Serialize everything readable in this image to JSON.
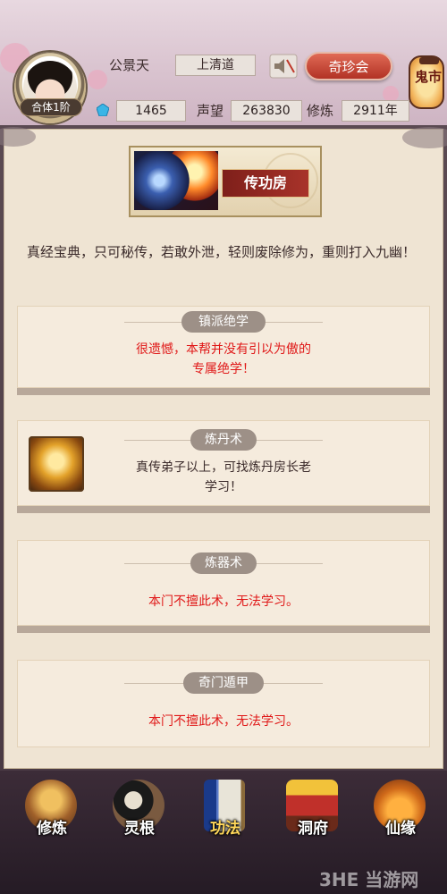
{
  "player": {
    "name": "公景天",
    "sect": "上清道",
    "rank": "合体1阶",
    "spirit_stones": "1465",
    "reputation_label": "声望",
    "reputation": "263830",
    "cultivation_label": "修炼",
    "cultivation": "2911年"
  },
  "header": {
    "treasure_button": "奇珍会",
    "ghost_market": "鬼市",
    "sound_icon": "speaker-muted-icon"
  },
  "banner": {
    "title": "传功房"
  },
  "intro_text": "真经宝典，只可秘传，若敢外泄，轻则废除修为，重则打入九幽！",
  "cards": [
    {
      "tab": "镇派绝学",
      "message": "很遗憾，本帮并没有引以为傲的\n专属绝学！",
      "style": "red"
    },
    {
      "tab": "炼丹术",
      "message": "真传弟子以上，可找炼丹房长老\n学习！",
      "style": "dark",
      "icon": "alchemy-cauldron-icon"
    },
    {
      "tab": "炼器术",
      "message": "本门不擅此术，无法学习。",
      "style": "red"
    },
    {
      "tab": "奇门遁甲",
      "message": "本门不擅此术，无法学习。",
      "style": "red"
    }
  ],
  "nav": [
    {
      "label": "修炼",
      "icon": "cultivation-icon",
      "active": false
    },
    {
      "label": "灵根",
      "icon": "spirit-root-icon",
      "active": false
    },
    {
      "label": "功法",
      "icon": "technique-book-icon",
      "active": true
    },
    {
      "label": "洞府",
      "icon": "cave-dwelling-icon",
      "active": false
    },
    {
      "label": "仙缘",
      "icon": "immortal-fate-icon",
      "active": false
    }
  ],
  "watermark": "3HE 当游网",
  "colors": {
    "accent_red": "#e01818",
    "button_red": "#c0392b",
    "panel_bg": "#efe4d3",
    "nav_active": "#ffd75a"
  }
}
